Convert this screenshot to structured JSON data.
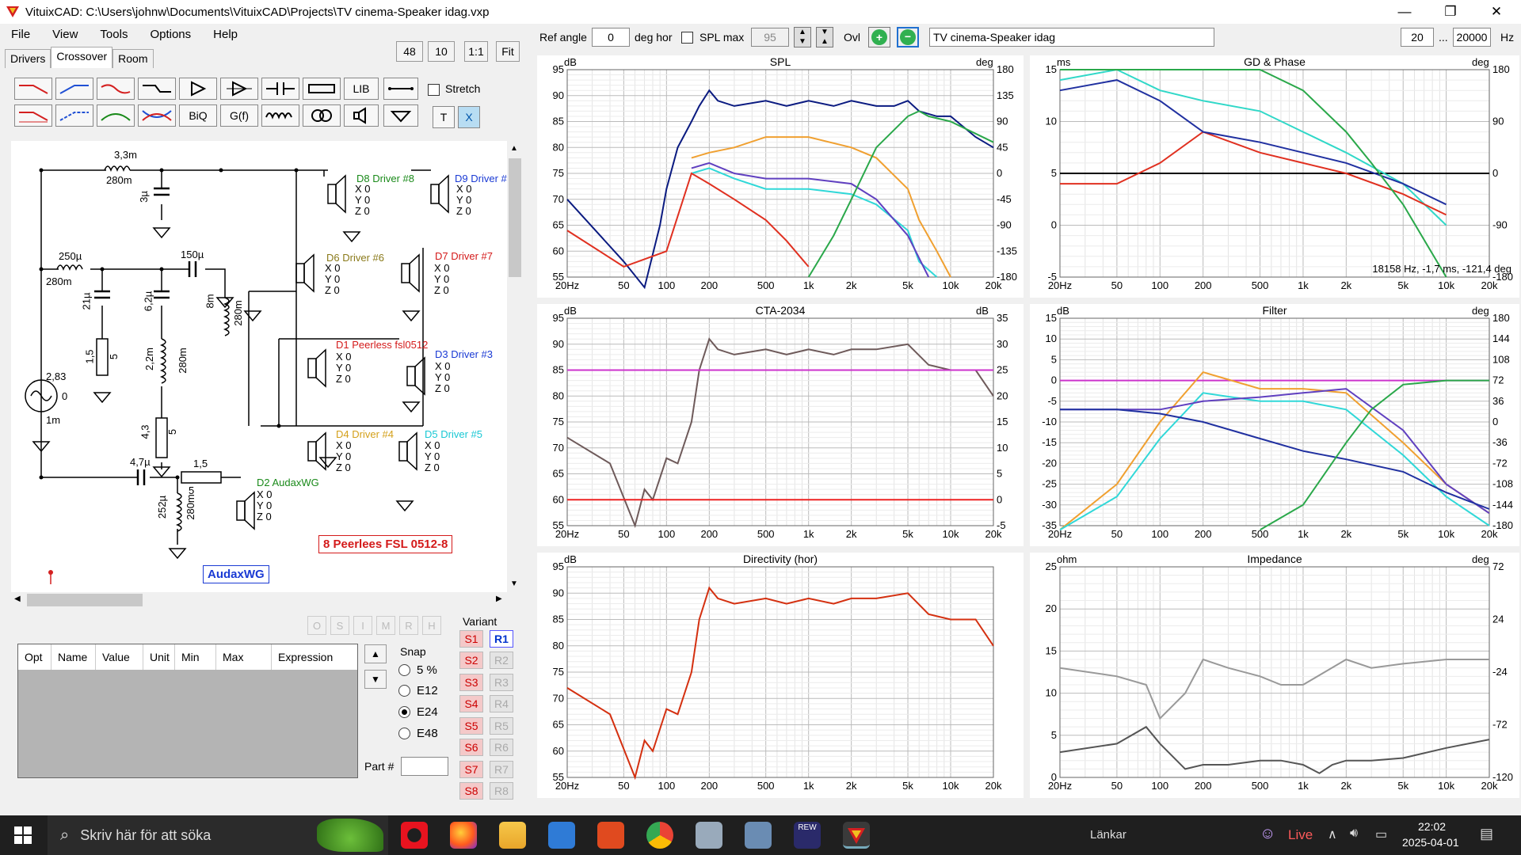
{
  "window": {
    "title": "VituixCAD: C:\\Users\\johnw\\Documents\\VituixCAD\\Projects\\TV cinema-Speaker idag.vxp",
    "minimize": "—",
    "maximize": "❐",
    "close": "✕"
  },
  "menu": [
    "File",
    "View",
    "Tools",
    "Options",
    "Help"
  ],
  "tabs": [
    "Drivers",
    "Crossover",
    "Room"
  ],
  "zoom": [
    "48",
    "10",
    "1:1",
    "Fit"
  ],
  "toolbar": {
    "row1_text": [
      "LIB"
    ],
    "row2_text": [
      "BiQ",
      "G(f)",
      "T",
      "X"
    ],
    "stretch": "Stretch"
  },
  "schematic": {
    "labels": [
      {
        "t": "3,3m",
        "c": "#000"
      },
      {
        "t": "280m",
        "c": "#000"
      },
      {
        "t": "3µ",
        "c": "#000"
      },
      {
        "t": "250µ",
        "c": "#000"
      },
      {
        "t": "280m",
        "c": "#000"
      },
      {
        "t": "150µ",
        "c": "#000"
      },
      {
        "t": "21µ",
        "c": "#000"
      },
      {
        "t": "6,2µ",
        "c": "#000"
      },
      {
        "t": "8m",
        "c": "#000"
      },
      {
        "t": "280m",
        "c": "#000"
      },
      {
        "t": "1,5",
        "c": "#000"
      },
      {
        "t": "5",
        "c": "#000"
      },
      {
        "t": "2,2m",
        "c": "#000"
      },
      {
        "t": "280m",
        "c": "#000"
      },
      {
        "t": "2,83",
        "c": "#000"
      },
      {
        "t": "0",
        "c": "#000"
      },
      {
        "t": "1m",
        "c": "#000"
      },
      {
        "t": "4,3",
        "c": "#000"
      },
      {
        "t": "5",
        "c": "#000"
      },
      {
        "t": "4,7µ",
        "c": "#000"
      },
      {
        "t": "1,5",
        "c": "#000"
      },
      {
        "t": "5",
        "c": "#000"
      },
      {
        "t": "252µ",
        "c": "#000"
      },
      {
        "t": "280m",
        "c": "#000"
      }
    ],
    "drivers": [
      {
        "name": "D8 Driver #8",
        "color": "#1a8a1a"
      },
      {
        "name": "D9 Driver #",
        "color": "#1a3ad4"
      },
      {
        "name": "D6 Driver #6",
        "color": "#8a7a1a"
      },
      {
        "name": "D7 Driver #7",
        "color": "#d41a1a"
      },
      {
        "name": "D1 Peerless fsl0512",
        "color": "#d41a1a"
      },
      {
        "name": "D3 Driver #3",
        "color": "#1a3ad4"
      },
      {
        "name": "D4 Driver #4",
        "color": "#d4a01a"
      },
      {
        "name": "D5 Driver #5",
        "color": "#1ac8d4"
      },
      {
        "name": "D2 AudaxWG",
        "color": "#1a8a1a"
      }
    ],
    "xyz": [
      "X 0",
      "Y 0",
      "Z 0"
    ],
    "note_red": "8 Peerlees FSL 0512-8",
    "note_blue": "AudaxWG"
  },
  "optimizer": {
    "buttons": [
      "O",
      "S",
      "I",
      "M",
      "R",
      "H"
    ]
  },
  "table": {
    "columns": [
      "Opt",
      "Name",
      "Value",
      "Unit",
      "Min",
      "Max",
      "Expression"
    ]
  },
  "snap": {
    "label": "Snap",
    "options": [
      "5 %",
      "E12",
      "E24",
      "E48"
    ],
    "selected": "E24"
  },
  "part": {
    "label": "Part #"
  },
  "variant": {
    "label": "Variant",
    "s": [
      "S1",
      "S2",
      "S3",
      "S4",
      "S5",
      "S6",
      "S7",
      "S8"
    ],
    "r": [
      "R1",
      "R2",
      "R3",
      "R4",
      "R5",
      "R6",
      "R7",
      "R8"
    ],
    "selected": "R1"
  },
  "top": {
    "ref_angle_label": "Ref angle",
    "ref_angle": "0",
    "deg_hor": "deg hor",
    "splmax_label": "SPL max",
    "splmax": "95",
    "ovl": "Ovl",
    "project": "TV cinema-Speaker idag",
    "f_lo": "20",
    "f_sep": "...",
    "f_hi": "20000",
    "hz": "Hz"
  },
  "xticks": [
    "20Hz",
    "50",
    "100",
    "200",
    "500",
    "1k",
    "2k",
    "5k",
    "10k",
    "20k"
  ],
  "charts": {
    "spl": {
      "title": "SPL",
      "lunit": "dB",
      "runit": "deg",
      "left": [
        "95",
        "90",
        "85",
        "80",
        "75",
        "70",
        "65",
        "60",
        "55"
      ],
      "right": [
        "180",
        "135",
        "90",
        "45",
        "0",
        "-45",
        "-90",
        "-135",
        "-180"
      ]
    },
    "gd": {
      "title": "GD & Phase",
      "lunit": "ms",
      "runit": "deg",
      "left": [
        "15",
        "10",
        "5",
        "0",
        "-5"
      ],
      "right": [
        "180",
        "90",
        "0",
        "-90",
        "-180"
      ],
      "readout": "18158 Hz, -1,7 ms, -121,4 deg"
    },
    "cta": {
      "title": "CTA-2034",
      "lunit": "dB",
      "runit": "dB",
      "left": [
        "95",
        "90",
        "85",
        "80",
        "75",
        "70",
        "65",
        "60",
        "55"
      ],
      "right": [
        "35",
        "30",
        "25",
        "20",
        "15",
        "10",
        "5",
        "0",
        "-5"
      ]
    },
    "filter": {
      "title": "Filter",
      "lunit": "dB",
      "runit": "deg",
      "left": [
        "15",
        "10",
        "5",
        "0",
        "-5",
        "-10",
        "-15",
        "-20",
        "-25",
        "-30",
        "-35"
      ],
      "right": [
        "180",
        "144",
        "108",
        "72",
        "36",
        "0",
        "-36",
        "-72",
        "-108",
        "-144",
        "-180"
      ]
    },
    "dir": {
      "title": "Directivity (hor)",
      "lunit": "dB",
      "left": [
        "95",
        "90",
        "85",
        "80",
        "75",
        "70",
        "65",
        "60",
        "55"
      ]
    },
    "imp": {
      "title": "Impedance",
      "lunit": "ohm",
      "runit": "deg",
      "left": [
        "25",
        "20",
        "15",
        "10",
        "5",
        "0"
      ],
      "right": [
        "72",
        "24",
        "-24",
        "-72",
        "-120"
      ]
    }
  },
  "chart_data": [
    {
      "type": "line",
      "title": "SPL",
      "xlabel": "Hz",
      "ylabel": "dB",
      "xscale": "log",
      "xlim": [
        20,
        20000
      ],
      "ylim": [
        55,
        95
      ],
      "series": [
        {
          "color": "#0a1a80",
          "x": [
            20,
            50,
            70,
            90,
            100,
            120,
            150,
            170,
            200,
            230,
            300,
            500,
            700,
            1000,
            1500,
            2000,
            3000,
            4000,
            5000,
            6000,
            8000,
            10000,
            15000,
            20000
          ],
          "y": [
            70,
            58,
            45,
            65,
            72,
            80,
            85,
            88,
            91,
            89,
            88,
            89,
            88,
            89,
            88,
            89,
            88,
            88,
            89,
            87,
            86,
            86,
            82,
            80
          ]
        },
        {
          "color": "#f0a030",
          "x": [
            150,
            200,
            300,
            500,
            1000,
            2000,
            3000,
            5000,
            6000,
            8000,
            10000
          ],
          "y": [
            78,
            79,
            80,
            82,
            82,
            80,
            78,
            72,
            66,
            60,
            55
          ]
        },
        {
          "color": "#30d8d8",
          "x": [
            150,
            200,
            300,
            500,
            1000,
            2000,
            3000,
            5000,
            6000,
            8000
          ],
          "y": [
            75,
            76,
            74,
            72,
            72,
            71,
            69,
            64,
            58,
            55
          ]
        },
        {
          "color": "#6040c0",
          "x": [
            150,
            200,
            300,
            500,
            1000,
            2000,
            3000,
            5000,
            7000
          ],
          "y": [
            76,
            77,
            75,
            74,
            74,
            73,
            70,
            63,
            55
          ]
        },
        {
          "color": "#e03020",
          "x": [
            20,
            50,
            100,
            150,
            200,
            300,
            500,
            700,
            1000
          ],
          "y": [
            64,
            57,
            60,
            75,
            73,
            70,
            66,
            62,
            57
          ]
        },
        {
          "color": "#2aa84a",
          "x": [
            1000,
            1500,
            2000,
            3000,
            5000,
            6000,
            7000,
            10000,
            20000
          ],
          "y": [
            55,
            63,
            70,
            80,
            86,
            87,
            86,
            85,
            81
          ]
        }
      ]
    },
    {
      "type": "line",
      "title": "CTA-2034",
      "xscale": "log",
      "xlim": [
        20,
        20000
      ],
      "ylim": [
        55,
        95
      ],
      "series": [
        {
          "color": "#6e5a5a",
          "x": [
            20,
            40,
            60,
            70,
            80,
            100,
            120,
            150,
            170,
            200,
            230,
            300,
            500,
            700,
            1000,
            1500,
            2000,
            3000,
            5000,
            7000,
            10000,
            15000,
            20000
          ],
          "y": [
            72,
            67,
            55,
            62,
            60,
            68,
            67,
            75,
            85,
            91,
            89,
            88,
            89,
            88,
            89,
            88,
            89,
            89,
            90,
            86,
            85,
            85,
            80
          ]
        },
        {
          "color": "#cc33cc",
          "x": [
            20,
            20000
          ],
          "y": [
            85,
            85
          ]
        },
        {
          "color": "#ee2222",
          "x": [
            20,
            20000
          ],
          "y": [
            60,
            60
          ]
        }
      ]
    },
    {
      "type": "line",
      "title": "Directivity (hor)",
      "xscale": "log",
      "xlim": [
        20,
        20000
      ],
      "ylim": [
        55,
        95
      ],
      "series": [
        {
          "color": "#d43010",
          "x": [
            20,
            40,
            60,
            70,
            80,
            100,
            120,
            150,
            170,
            200,
            230,
            300,
            500,
            700,
            1000,
            1500,
            2000,
            3000,
            5000,
            7000,
            10000,
            15000,
            20000
          ],
          "y": [
            72,
            67,
            55,
            62,
            60,
            68,
            67,
            75,
            85,
            91,
            89,
            88,
            89,
            88,
            89,
            88,
            89,
            89,
            90,
            86,
            85,
            85,
            80
          ]
        }
      ]
    },
    {
      "type": "line",
      "title": "Impedance",
      "xscale": "log",
      "xlim": [
        20,
        20000
      ],
      "ylim": [
        0,
        25
      ],
      "series": [
        {
          "color": "#555",
          "x": [
            20,
            50,
            80,
            100,
            150,
            200,
            300,
            500,
            700,
            1000,
            1300,
            1600,
            2000,
            3000,
            5000,
            10000,
            20000
          ],
          "y": [
            3,
            4,
            6,
            4,
            1,
            1.5,
            1.5,
            2,
            2,
            1.5,
            0.5,
            1.5,
            2,
            2,
            2.3,
            3.5,
            4.5
          ]
        },
        {
          "color": "#999",
          "x": [
            20,
            50,
            80,
            100,
            150,
            200,
            300,
            500,
            700,
            1000,
            2000,
            3000,
            5000,
            10000,
            20000
          ],
          "y": [
            13,
            12,
            11,
            7,
            10,
            14,
            13,
            12,
            11,
            11,
            14,
            13,
            13.5,
            14,
            14
          ]
        }
      ]
    }
  ],
  "taskbar": {
    "search": "Skriv här för att söka",
    "links": "Länkar",
    "live": "Live",
    "time": "22:02",
    "date": "2025-04-01"
  }
}
